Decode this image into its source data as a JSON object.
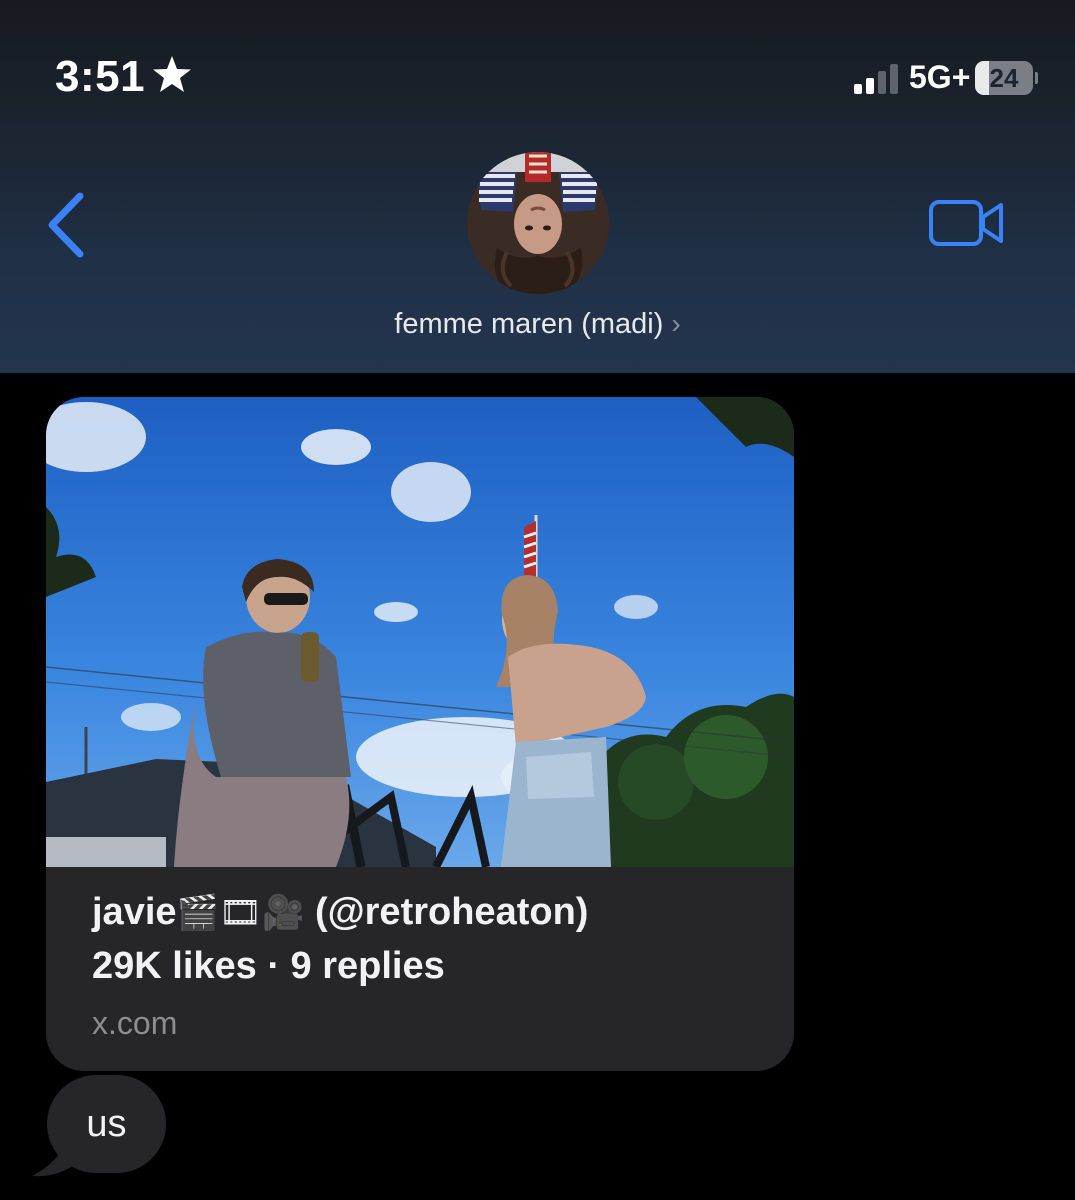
{
  "status_bar": {
    "time": "3:51",
    "star_icon": "star-icon",
    "network": "5G+",
    "battery_level": "24",
    "battery_fraction": 0.24,
    "signal_bars_active": 2,
    "signal_bars_total": 4
  },
  "header": {
    "back_icon": "chevron-left-icon",
    "contact_name": "femme maren (madi)",
    "contact_chevron": "›",
    "video_icon": "video-camera-icon",
    "accent_color": "#3a82f7"
  },
  "link_preview": {
    "title_name": "javie",
    "title_emojis": "🎬🎞🎥",
    "title_handle": "(@retroheaton)",
    "stats": "29K likes · 9 replies",
    "domain": "x.com"
  },
  "messages": [
    {
      "text": "us",
      "direction": "incoming"
    }
  ]
}
